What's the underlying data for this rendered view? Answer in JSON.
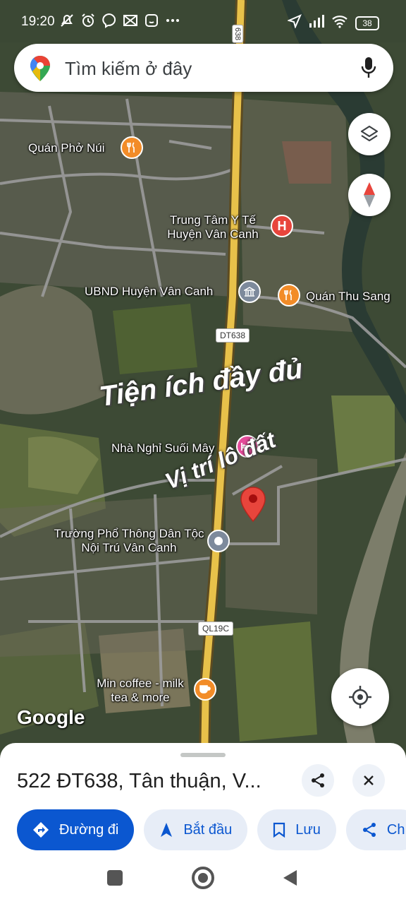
{
  "status_bar": {
    "time": "19:20",
    "battery": "38",
    "left_icons": [
      "mute-icon",
      "alarm-icon",
      "messenger-icon",
      "mail-icon",
      "face-icon",
      "more-dots-icon"
    ],
    "right_icons": [
      "location-icon",
      "signal-icon",
      "wifi-icon",
      "battery-icon"
    ]
  },
  "search": {
    "placeholder": "Tìm kiếm ở đây"
  },
  "map": {
    "road_labels": [
      "638",
      "DT638",
      "QL19C"
    ],
    "pois": [
      {
        "name": "Quán Phở Núi",
        "icon": "restaurant-icon",
        "color": "#f28c28"
      },
      {
        "name": "Trung Tâm Y Tế Huyện Vân Canh",
        "icon": "hospital-icon",
        "color": "#e8453c"
      },
      {
        "name": "UBND Huyện Vân Canh",
        "icon": "government-icon",
        "color": "#7d8a9c"
      },
      {
        "name": "Quán Thu Sang",
        "icon": "restaurant-icon",
        "color": "#f28c28"
      },
      {
        "name": "Nhà Nghỉ Suối Mây",
        "icon": "hotel-icon",
        "color": "#e44c9a"
      },
      {
        "name": "Trường Phổ Thông Dân Tộc Nội Trú Vân Canh",
        "icon": "school-icon",
        "color": "#7d8a9c"
      },
      {
        "name": "Min coffee - milk tea & more",
        "icon": "cafe-icon",
        "color": "#f28c28"
      }
    ],
    "overlay_text_1": "Tiện ích đầy đủ",
    "overlay_text_2": "Vị trí lô đất",
    "watermark": "Google"
  },
  "sheet": {
    "address": "522 ĐT638, Tân thuận, V...",
    "actions": {
      "directions": "Đường đi",
      "start": "Bắt đầu",
      "save": "Lưu",
      "share": "Ch"
    }
  },
  "colors": {
    "primary": "#0b57d0",
    "chip_bg": "#e7edf7",
    "road": "#e8c14a"
  }
}
